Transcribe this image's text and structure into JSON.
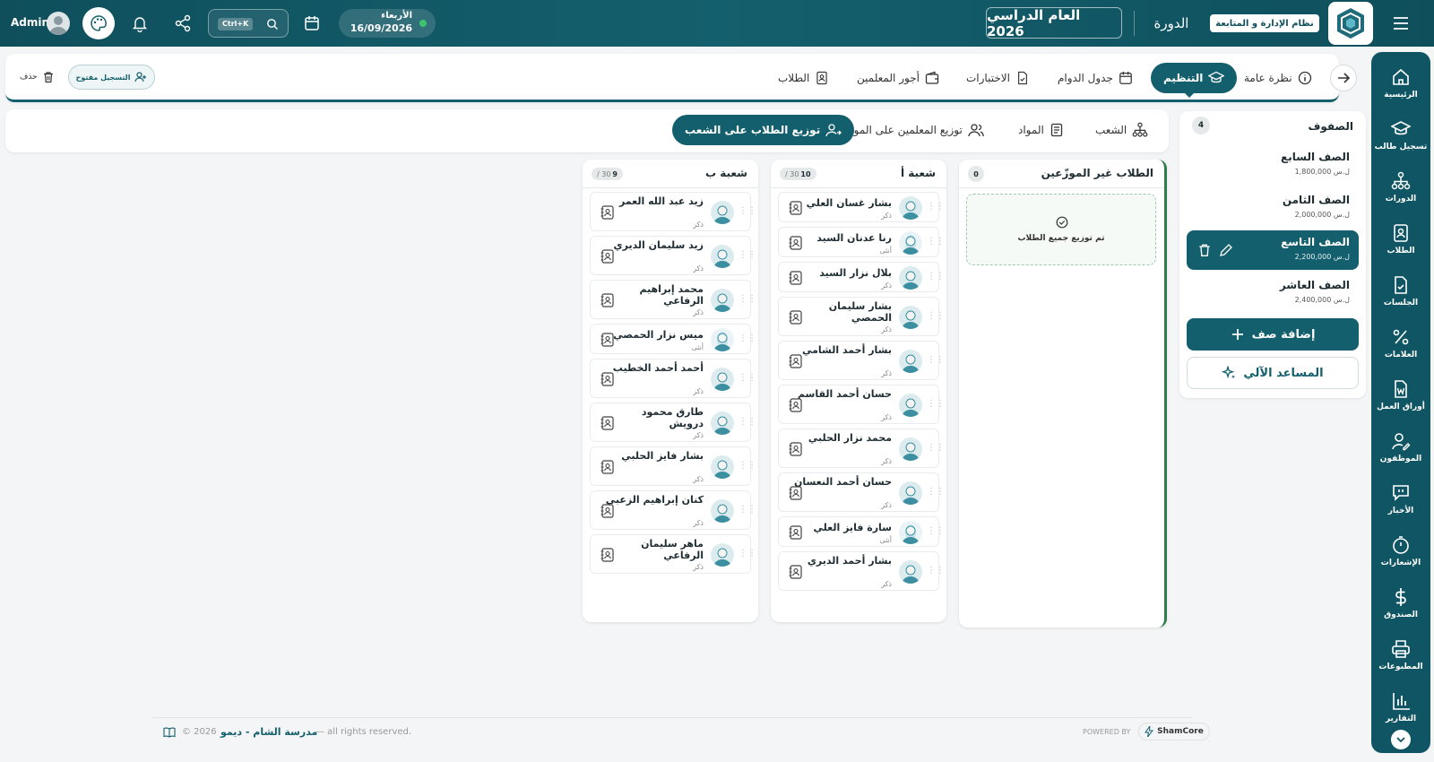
{
  "topbar": {
    "brand_label": "نظام الإدارة و المتابعة",
    "course_label": "الدورة",
    "year_label": "العام الدراسي 2026",
    "day": "الأربعاء",
    "date": "16/09/2026",
    "search_shortcut": "Ctrl+K",
    "user_name": "Admin"
  },
  "sidebar": {
    "items": [
      {
        "label": "الرئيسية",
        "icon": "home-icon"
      },
      {
        "label": "تسجيل طالب",
        "icon": "graduation-cap-icon"
      },
      {
        "label": "الدورات",
        "icon": "hierarchy-icon"
      },
      {
        "label": "الطلاب",
        "icon": "student-card-icon"
      },
      {
        "label": "الجلسات",
        "icon": "file-check-icon"
      },
      {
        "label": "العلامات",
        "icon": "percent-icon"
      },
      {
        "label": "أوراق العمل",
        "icon": "word-file-icon"
      },
      {
        "label": "الموظفون",
        "icon": "user-edit-icon"
      },
      {
        "label": "الأخبار",
        "icon": "chat-icon"
      },
      {
        "label": "الإشعارات",
        "icon": "timer-icon"
      },
      {
        "label": "الصندوق",
        "icon": "dollar-icon"
      },
      {
        "label": "المطبوعات",
        "icon": "printer-icon"
      },
      {
        "label": "التقارير",
        "icon": "bar-chart-icon"
      }
    ]
  },
  "tabs": {
    "overview": "نظرة عامة",
    "organize": "التنظيم",
    "schedule": "جدول الدوام",
    "exams": "الاختبارات",
    "teacher_wages": "أجور المعلمين",
    "students": "الطلاب",
    "open_registration": "التسجيل مفتوح",
    "delete": "حذف"
  },
  "subtabs": {
    "sections": "الشعب",
    "subjects": "المواد",
    "teachers_distribution": "توزيع المعلمين على المواد",
    "students_distribution": "توزيع الطلاب على الشعب"
  },
  "grades_panel": {
    "title": "الصفوف",
    "count": "4",
    "grades": [
      {
        "name": "الصف السابع",
        "price": "1,800,000",
        "currency": "ل.س"
      },
      {
        "name": "الصف الثامن",
        "price": "2,000,000",
        "currency": "ل.س"
      },
      {
        "name": "الصف التاسع",
        "price": "2,200,000",
        "currency": "ل.س"
      },
      {
        "name": "الصف العاشر",
        "price": "2,400,000",
        "currency": "ل.س"
      }
    ],
    "add_button": "إضافة صف",
    "assistant_button": "المساعد الآلي"
  },
  "unassigned": {
    "title": "الطلاب غير الموزّعين",
    "count": "0",
    "empty_message": "تم توزيع جميع الطلاب"
  },
  "section_a": {
    "title": "شعبة أ",
    "current": "10",
    "capacity": "/ 30",
    "students": [
      {
        "name": "بشار غسان العلي",
        "gender": "ذكر"
      },
      {
        "name": "رنا عدنان السيد",
        "gender": "أنثى"
      },
      {
        "name": "بلال نزار السيد",
        "gender": "ذكر"
      },
      {
        "name": "بشار سليمان الحمصي",
        "gender": "ذكر"
      },
      {
        "name": "بشار أحمد الشامي",
        "gender": "ذكر"
      },
      {
        "name": "حسان أحمد القاسم",
        "gender": "ذكر"
      },
      {
        "name": "محمد نزار الحلبي",
        "gender": "ذكر"
      },
      {
        "name": "حسان أحمد النعسان",
        "gender": "ذكر"
      },
      {
        "name": "سارة فايز العلي",
        "gender": "أنثى"
      },
      {
        "name": "بشار أحمد الديري",
        "gender": "ذكر"
      }
    ]
  },
  "section_b": {
    "title": "شعبة ب",
    "current": "9",
    "capacity": "/ 30",
    "students": [
      {
        "name": "زيد عبد الله العمر",
        "gender": "ذكر"
      },
      {
        "name": "زيد سليمان الديري",
        "gender": "ذكر"
      },
      {
        "name": "محمد إبراهيم الرفاعي",
        "gender": "ذكر"
      },
      {
        "name": "ميس نزار الحمصي",
        "gender": "أنثى"
      },
      {
        "name": "أحمد أحمد الخطيب",
        "gender": "ذكر"
      },
      {
        "name": "طارق محمود درويش",
        "gender": "ذكر"
      },
      {
        "name": "بشار فايز الحلبي",
        "gender": "ذكر"
      },
      {
        "name": "كنان إبراهيم الزعبي",
        "gender": "ذكر"
      },
      {
        "name": "ماهر سليمان الرفاعي",
        "gender": "ذكر"
      }
    ]
  },
  "footer": {
    "copyright": "© 2026",
    "school": "مدرسة الشام - ديمو",
    "rights": "— all rights reserved.",
    "powered_by": "POWERED BY",
    "vendor": "ShamCore"
  },
  "colors": {
    "primary": "#145f6d",
    "sidebar": "#0f5563",
    "accent_green": "#2f7d4a"
  }
}
